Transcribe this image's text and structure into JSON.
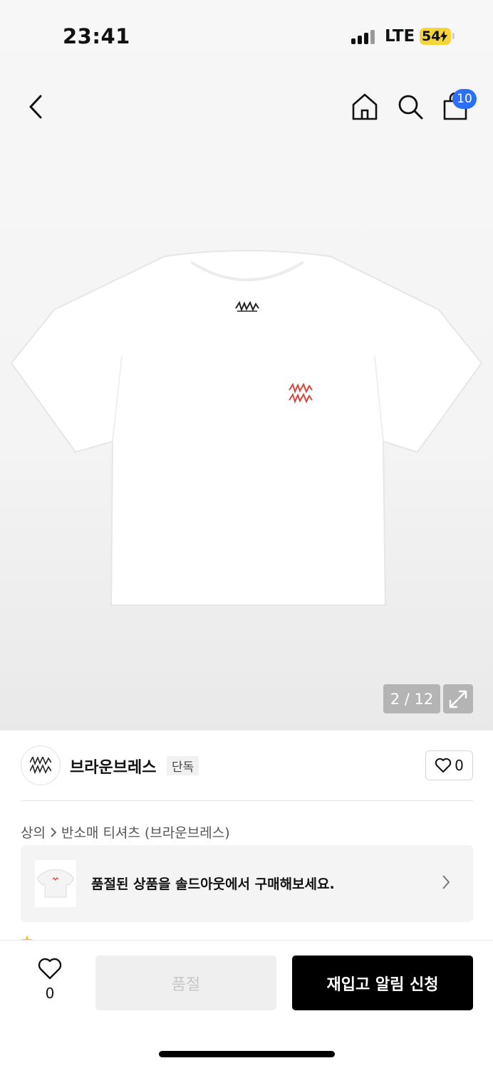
{
  "status_bar": {
    "time": "23:41",
    "network": "LTE",
    "battery": "54"
  },
  "header": {
    "cart_count": "10"
  },
  "hero": {
    "image_counter": "2 / 12"
  },
  "brand": {
    "name": "브라운브레스",
    "tag": "단독",
    "like_count": "0"
  },
  "breadcrumb": {
    "category": "상의",
    "subcategory": "반소매 티셔츠 (브라운브레스)"
  },
  "soldout_banner": {
    "text": "품절된 상품을 솔드아웃에서 구매해보세요."
  },
  "bottom_bar": {
    "wish_count": "0",
    "soldout_label": "품절",
    "restock_label": "재입고 알림 신청"
  },
  "colors": {
    "accent_blue": "#2b6ff7",
    "battery_yellow": "#f5d33a",
    "cta_black": "#000000"
  }
}
